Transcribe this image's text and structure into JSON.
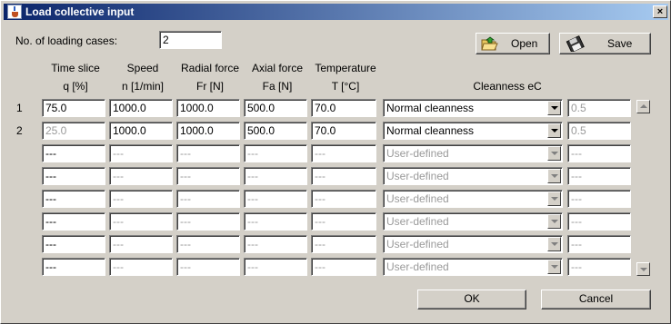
{
  "window": {
    "title": "Load collective input",
    "close_glyph": "×"
  },
  "header": {
    "cases_label": "No. of loading cases:",
    "cases_value": "2",
    "open_label": "Open",
    "save_label": "Save"
  },
  "columns": [
    {
      "line1": "Time slice",
      "line2": "q [%]"
    },
    {
      "line1": "Speed",
      "line2": "n [1/min]"
    },
    {
      "line1": "Radial force",
      "line2": "Fr [N]"
    },
    {
      "line1": "Axial force",
      "line2": "Fa [N]"
    },
    {
      "line1": "Temperature",
      "line2": "T [°C]"
    },
    {
      "line1": "",
      "line2": "Cleanness eC"
    }
  ],
  "rows": [
    {
      "num": "1",
      "q": "75.0",
      "n": "1000.0",
      "fr": "1000.0",
      "fa": "500.0",
      "t": "70.0",
      "clean": "Normal cleanness",
      "ec": "0.5"
    },
    {
      "num": "2",
      "q": "25.0",
      "n": "1000.0",
      "fr": "1000.0",
      "fa": "500.0",
      "t": "70.0",
      "clean": "Normal cleanness",
      "ec": "0.5"
    },
    {
      "num": "",
      "q": "---",
      "n": "---",
      "fr": "---",
      "fa": "---",
      "t": "---",
      "clean": "User-defined",
      "ec": "---"
    },
    {
      "num": "",
      "q": "---",
      "n": "---",
      "fr": "---",
      "fa": "---",
      "t": "---",
      "clean": "User-defined",
      "ec": "---"
    },
    {
      "num": "",
      "q": "---",
      "n": "---",
      "fr": "---",
      "fa": "---",
      "t": "---",
      "clean": "User-defined",
      "ec": "---"
    },
    {
      "num": "",
      "q": "---",
      "n": "---",
      "fr": "---",
      "fa": "---",
      "t": "---",
      "clean": "User-defined",
      "ec": "---"
    },
    {
      "num": "",
      "q": "---",
      "n": "---",
      "fr": "---",
      "fa": "---",
      "t": "---",
      "clean": "User-defined",
      "ec": "---"
    },
    {
      "num": "",
      "q": "---",
      "n": "---",
      "fr": "---",
      "fa": "---",
      "t": "---",
      "clean": "User-defined",
      "ec": "---"
    }
  ],
  "footer": {
    "ok_label": "OK",
    "cancel_label": "Cancel"
  },
  "icons": {
    "title": "java-cup-icon",
    "open": "open-folder-icon",
    "save": "floppy-disk-icon"
  }
}
